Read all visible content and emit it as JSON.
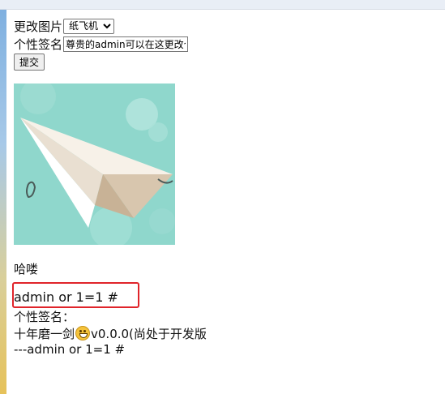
{
  "form": {
    "image_label": "更改图片",
    "image_select_value": "纸飞机",
    "signature_label": "个性签名",
    "signature_input_value": "尊贵的admin可以在这更改个",
    "submit_label": "提交"
  },
  "image": {
    "icon": "paper-plane-image"
  },
  "profile": {
    "greeting": "哈喽",
    "username": "admin or 1=1 #",
    "signature_heading": "个性签名：",
    "signature_prefix": "十年磨一剑",
    "signature_emoji": "grinning-face-icon",
    "signature_suffix": "v0.0.0(尚处于开发版",
    "signature_author": "---admin or 1=1 #"
  },
  "colors": {
    "highlight_border": "#e0242a",
    "image_background": "#8fd7cc"
  }
}
